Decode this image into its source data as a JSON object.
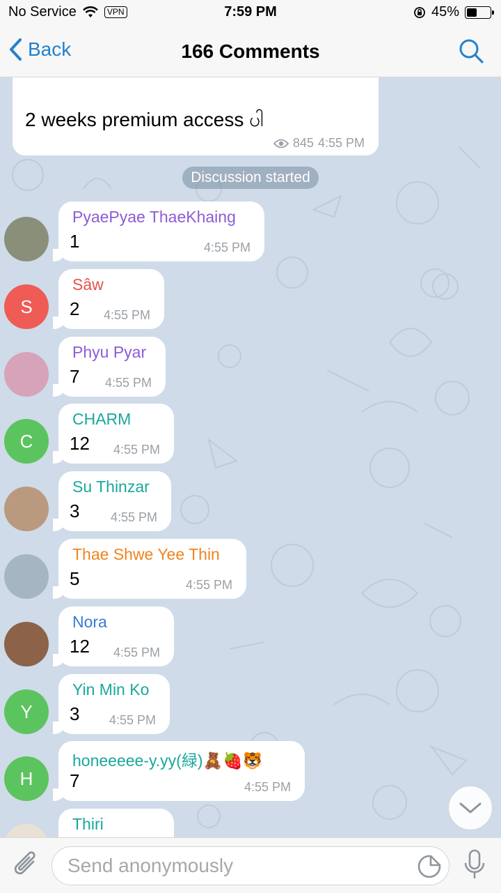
{
  "status_bar": {
    "carrier": "No Service",
    "vpn": "VPN",
    "time": "7:59 PM",
    "battery": "45%",
    "battery_level": 0.45
  },
  "nav": {
    "back_label": "Back",
    "title": "166 Comments"
  },
  "post": {
    "text": "2 weeks premium access ပါ",
    "views": "845",
    "time": "4:55 PM"
  },
  "service_message": "Discussion started",
  "comments": [
    {
      "name": "PyaePyae ThaeKhaing",
      "text": "1",
      "time": "4:55 PM",
      "name_color": "#8e5bd6",
      "avatar_initial": "",
      "avatar_color": "#8a8f7a"
    },
    {
      "name": "Sâw",
      "text": "2",
      "time": "4:55 PM",
      "name_color": "#e5534b",
      "avatar_initial": "S",
      "avatar_color": "#ee5c55"
    },
    {
      "name": "Phyu Pyar",
      "text": "7",
      "time": "4:55 PM",
      "name_color": "#8e5bd6",
      "avatar_initial": "",
      "avatar_color": "#d6a3b8"
    },
    {
      "name": "CHARM",
      "text": "12",
      "time": "4:55 PM",
      "name_color": "#1aa89a",
      "avatar_initial": "C",
      "avatar_color": "#5cc45e"
    },
    {
      "name": "Su Thinzar",
      "text": "3",
      "time": "4:55 PM",
      "name_color": "#1aa89a",
      "avatar_initial": "",
      "avatar_color": "#b99a7e"
    },
    {
      "name": "Thae Shwe Yee Thin",
      "text": "5",
      "time": "4:55 PM",
      "name_color": "#f0831e",
      "avatar_initial": "",
      "avatar_color": "#a5b6c2"
    },
    {
      "name": "Nora",
      "text": "12",
      "time": "4:55 PM",
      "name_color": "#3a7bd5",
      "avatar_initial": "",
      "avatar_color": "#8c6248"
    },
    {
      "name": "Yin Min Ko",
      "text": "3",
      "time": "4:55 PM",
      "name_color": "#1aa89a",
      "avatar_initial": "Y",
      "avatar_color": "#5cc45e"
    },
    {
      "name": "honeeeee-y.yy(緑)🧸🍓🐯",
      "text": "7",
      "time": "4:55 PM",
      "name_color": "#1aa89a",
      "avatar_initial": "H",
      "avatar_color": "#5cc45e"
    },
    {
      "name": "Thiri",
      "text": "",
      "time": "",
      "name_color": "#1aa89a",
      "avatar_initial": "",
      "avatar_color": "#e9e2d4"
    }
  ],
  "input": {
    "placeholder": "Send anonymously"
  }
}
